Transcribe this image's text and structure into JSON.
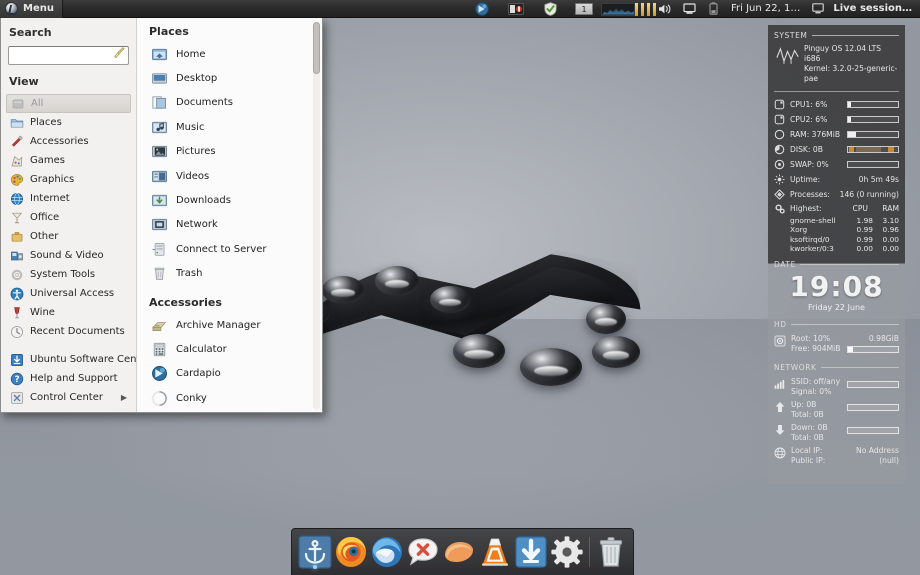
{
  "top_panel": {
    "menu_label": "Menu",
    "tray_left": [
      {
        "name": "cardapio-tray-icon",
        "title": "Cardapio"
      },
      {
        "name": "battery-monitor-icon",
        "title": "Battery"
      },
      {
        "name": "shield-icon",
        "title": "Security"
      },
      {
        "name": "workspace-switcher",
        "title": "1"
      },
      {
        "name": "network-graph-icon",
        "title": "Network graph"
      },
      {
        "name": "cpu-bars-icon",
        "title": "CPU bars"
      }
    ],
    "workspace_number": "1",
    "tray_right": [
      {
        "name": "volume-icon",
        "title": "Volume"
      },
      {
        "name": "display-icon",
        "title": "Display"
      },
      {
        "name": "battery-icon",
        "title": "Battery"
      }
    ],
    "clock": "Fri Jun 22, 1…",
    "session": "Live session…"
  },
  "menu": {
    "search": {
      "title": "Search",
      "value": "",
      "placeholder": ""
    },
    "view": {
      "title": "View",
      "items": [
        {
          "label": "All",
          "icon": "all-icon",
          "selected": true
        },
        {
          "label": "Places",
          "icon": "places-folder-icon",
          "selected": false
        },
        {
          "label": "Accessories",
          "icon": "accessories-icon",
          "selected": false
        },
        {
          "label": "Games",
          "icon": "games-icon",
          "selected": false
        },
        {
          "label": "Graphics",
          "icon": "graphics-icon",
          "selected": false
        },
        {
          "label": "Internet",
          "icon": "internet-globe-icon",
          "selected": false
        },
        {
          "label": "Office",
          "icon": "office-icon",
          "selected": false
        },
        {
          "label": "Other",
          "icon": "other-icon",
          "selected": false
        },
        {
          "label": "Sound & Video",
          "icon": "sound-video-icon",
          "selected": false
        },
        {
          "label": "System Tools",
          "icon": "system-tools-icon",
          "selected": false
        },
        {
          "label": "Universal Access",
          "icon": "universal-access-icon",
          "selected": false
        },
        {
          "label": "Wine",
          "icon": "wine-glass-icon",
          "selected": false
        },
        {
          "label": "Recent Documents",
          "icon": "recent-documents-icon",
          "selected": false
        }
      ],
      "bottom_items": [
        {
          "label": "Ubuntu Software Center",
          "icon": "software-center-icon"
        },
        {
          "label": "Help and Support",
          "icon": "help-icon"
        },
        {
          "label": "Control Center",
          "icon": "control-center-icon",
          "submenu": true
        }
      ]
    },
    "places": {
      "title": "Places",
      "items": [
        {
          "label": "Home",
          "icon": "home-folder-icon"
        },
        {
          "label": "Desktop",
          "icon": "desktop-icon"
        },
        {
          "label": "Documents",
          "icon": "documents-folder-icon"
        },
        {
          "label": "Music",
          "icon": "music-folder-icon"
        },
        {
          "label": "Pictures",
          "icon": "pictures-folder-icon"
        },
        {
          "label": "Videos",
          "icon": "videos-folder-icon"
        },
        {
          "label": "Downloads",
          "icon": "downloads-folder-icon"
        },
        {
          "label": "Network",
          "icon": "network-folder-icon"
        },
        {
          "label": "Connect to Server",
          "icon": "connect-server-icon"
        },
        {
          "label": "Trash",
          "icon": "trash-icon"
        }
      ]
    },
    "accessories": {
      "title": "Accessories",
      "items": [
        {
          "label": "Archive Manager",
          "icon": "archive-manager-icon"
        },
        {
          "label": "Calculator",
          "icon": "calculator-icon"
        },
        {
          "label": "Cardapio",
          "icon": "cardapio-icon"
        },
        {
          "label": "Conky",
          "icon": "conky-icon"
        }
      ]
    }
  },
  "conky": {
    "system": {
      "heading": "SYSTEM",
      "os": "Pinguy OS 12.04 LTS i686",
      "kernel": "Kernel: 3.2.0-25-generic-pae",
      "stats": [
        {
          "label": "CPU1: 6%",
          "icon": "cpu-icon",
          "percent": 6
        },
        {
          "label": "CPU2: 6%",
          "icon": "cpu-icon",
          "percent": 6
        },
        {
          "label": "RAM: 376MiB",
          "icon": "ram-icon",
          "percent": 16
        },
        {
          "label": "DISK: 0B",
          "icon": "disk-icon",
          "percent": 0
        },
        {
          "label": "SWAP: 0%",
          "icon": "swap-icon",
          "percent": 0
        }
      ],
      "uptime_label": "Uptime:",
      "uptime_value": "0h 5m 49s",
      "processes_label": "Processes:",
      "processes_value": "146 (0 running)",
      "highest_label": "Highest:",
      "col_cpu": "CPU",
      "col_ram": "RAM",
      "processes": [
        {
          "name": "gnome-shell",
          "cpu": "1.98",
          "ram": "3.10"
        },
        {
          "name": "Xorg",
          "cpu": "0.99",
          "ram": "0.96"
        },
        {
          "name": "ksoftirqd/0",
          "cpu": "0.99",
          "ram": "0.00"
        },
        {
          "name": "kworker/0:3",
          "cpu": "0.00",
          "ram": "0.00"
        }
      ]
    },
    "date": {
      "heading": "DATE",
      "time": "19:08",
      "date": "Friday 22 June"
    },
    "hd": {
      "heading": "HD",
      "root_label": "Root: 10%",
      "free_label": "Free: 904MiB",
      "size": "0.98GiB",
      "percent": 10
    },
    "network": {
      "heading": "NETWORK",
      "ssid_label": "SSID: off/any",
      "signal_label": "Signal: 0%",
      "signal_percent": 0,
      "up_label": "Up: 0B",
      "up_total": "Total: 0B",
      "up_percent": 0,
      "down_label": "Down: 0B",
      "down_total": "Total: 0B",
      "down_percent": 0,
      "local_ip_label": "Local IP:",
      "local_ip_value": "No Address",
      "public_ip_label": "Public IP:",
      "public_ip_value": "(null)"
    }
  },
  "dock": {
    "items": [
      {
        "name": "docky-anchor-icon",
        "label": "Docky",
        "active": true
      },
      {
        "name": "firefox-icon",
        "label": "Firefox",
        "active": false
      },
      {
        "name": "thunderbird-icon",
        "label": "Thunderbird",
        "active": false
      },
      {
        "name": "pidgin-icon",
        "label": "Pidgin",
        "active": false
      },
      {
        "name": "clementine-icon",
        "label": "Clementine",
        "active": false
      },
      {
        "name": "vlc-icon",
        "label": "VLC media player",
        "active": false
      },
      {
        "name": "downloader-icon",
        "label": "Downloader",
        "active": false
      },
      {
        "name": "settings-gear-icon",
        "label": "Settings",
        "active": false
      },
      {
        "name": "trash-icon",
        "label": "Trash",
        "active": false
      }
    ]
  },
  "colors": {
    "panel_dark": "#2b2b2b",
    "menu_bg": "#f2f1f0",
    "accent_orange": "#d08a2c",
    "desktop": "#a9adb4"
  }
}
